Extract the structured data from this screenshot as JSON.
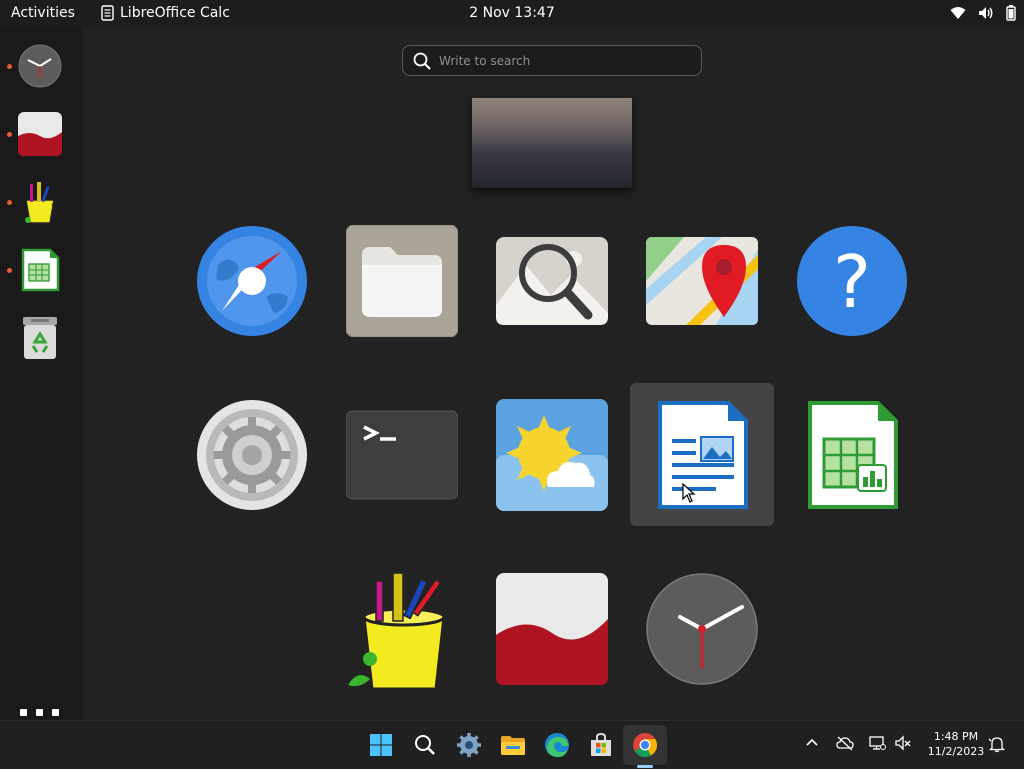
{
  "topbar": {
    "activities": "Activities",
    "app_name": "LibreOffice Calc",
    "clock": "2 Nov  13:47"
  },
  "search": {
    "placeholder": "Write to search"
  },
  "dock": {
    "items": [
      {
        "name": "Clocks",
        "running": true
      },
      {
        "name": "Shotwell",
        "running": true
      },
      {
        "name": "Paint",
        "running": true
      },
      {
        "name": "LibreOffice Calc",
        "running": true
      },
      {
        "name": "Trash",
        "running": false
      }
    ]
  },
  "apps": [
    {
      "name": "Web"
    },
    {
      "name": "Files"
    },
    {
      "name": "Image Viewer"
    },
    {
      "name": "Maps"
    },
    {
      "name": "Help"
    },
    {
      "name": "Settings"
    },
    {
      "name": "Terminal"
    },
    {
      "name": "Weather"
    },
    {
      "name": "LibreOffice Writer",
      "selected": true
    },
    {
      "name": "LibreOffice Calc"
    },
    {
      "name": "Paint"
    },
    {
      "name": "Shotwell"
    },
    {
      "name": "Clocks"
    }
  ],
  "taskbar": {
    "time": "1:48 PM",
    "date": "11/2/2023"
  },
  "colors": {
    "running_dot": "#e45b3a",
    "selection": "#444444",
    "taskbar_active": "#9acbff"
  }
}
